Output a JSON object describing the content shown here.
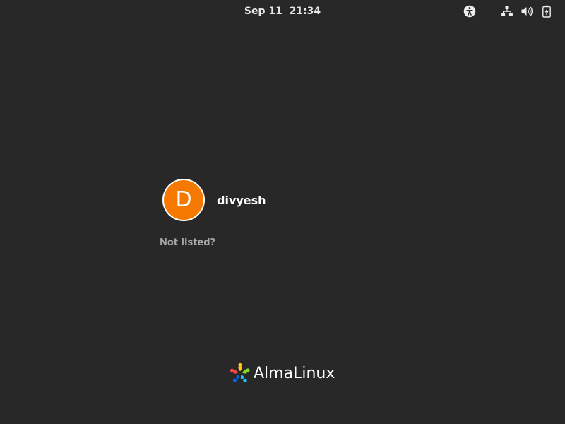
{
  "topbar": {
    "clock": "Sep 11  21:34",
    "icons": [
      "accessibility-icon",
      "network-icon",
      "volume-icon",
      "battery-icon"
    ]
  },
  "user_list": {
    "users": [
      {
        "initial": "D",
        "name": "divyesh",
        "avatar_color": "#f57900"
      }
    ],
    "not_listed_label": "Not listed?"
  },
  "branding": {
    "logo_text": "AlmaLinux"
  },
  "colors": {
    "background": "#282828",
    "avatar": "#f57900",
    "text": "#ffffff",
    "muted_text": "#a8a8a8"
  }
}
